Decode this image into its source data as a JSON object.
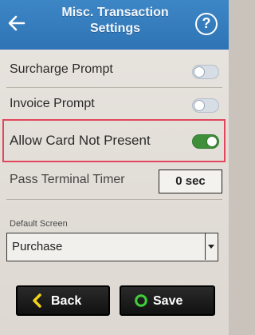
{
  "header": {
    "title_line1": "Misc. Transaction",
    "title_line2": "Settings"
  },
  "settings": [
    {
      "label": "Surcharge Prompt",
      "enabled": false
    },
    {
      "label": "Invoice Prompt",
      "enabled": false
    },
    {
      "label": "Allow Card Not Present",
      "enabled": true
    }
  ],
  "timer": {
    "label": "Pass Terminal Timer",
    "value": "0 sec"
  },
  "default_screen": {
    "label": "Default Screen",
    "value": "Purchase"
  },
  "buttons": {
    "back": "Back",
    "save": "Save"
  },
  "colors": {
    "header": "#2e74b5",
    "toggle_on": "#3f8f3a",
    "toggle_off": "#d7dde5",
    "highlight": "#e2475c",
    "button": "#111111"
  },
  "icons": {
    "back": "arrow-left-icon",
    "help": "question-icon",
    "back_button": "chevron-left-icon",
    "save_button": "circle-icon"
  }
}
